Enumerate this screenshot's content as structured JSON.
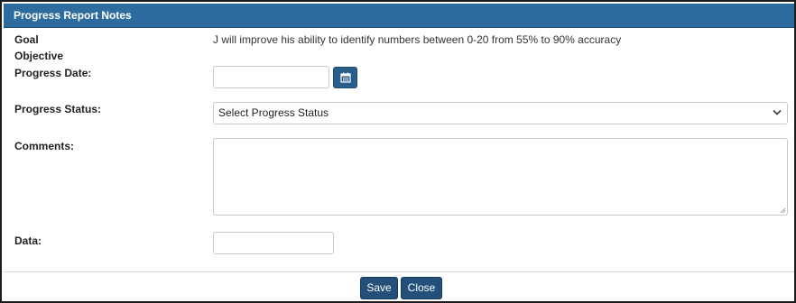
{
  "dialog": {
    "title": "Progress Report Notes"
  },
  "form": {
    "goal_label": "Goal",
    "goal_text": "J will improve his ability to identify numbers between 0-20 from 55% to 90% accuracy",
    "objective_label": "Objective",
    "progress_date_label": "Progress Date:",
    "progress_date_value": "",
    "progress_status_label": "Progress Status:",
    "progress_status_selected": "Select Progress Status",
    "comments_label": "Comments:",
    "comments_value": "",
    "data_label": "Data:",
    "data_value": ""
  },
  "footer": {
    "save_label": "Save",
    "close_label": "Close"
  },
  "colors": {
    "header_bg": "#2e6b9e",
    "button_bg": "#234f7a"
  },
  "icons": {
    "calendar": "calendar-icon",
    "dropdown": "chevron-down-icon"
  }
}
